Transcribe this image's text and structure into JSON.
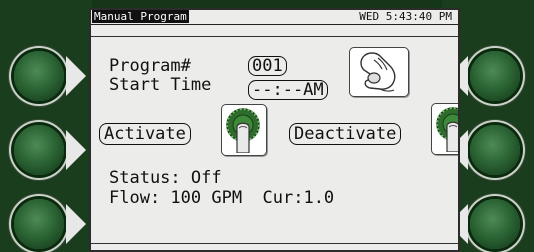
{
  "header": {
    "title": "Manual Program",
    "clock": "WED 5:43:40 PM"
  },
  "program": {
    "label": "Program#",
    "number": "001",
    "start_label": "Start Time",
    "start_value": "--:--AM"
  },
  "buttons": {
    "activate": "Activate",
    "deactivate": "Deactivate"
  },
  "status": {
    "status_line": "Status: Off",
    "flow_line": "Flow: 100 GPM  Cur:1.0"
  },
  "colors": {
    "bezel": "#16361a",
    "button_green": "#2c6535",
    "screen_bg": "#ececea",
    "dial_green": "#2e6b2c"
  },
  "icons": [
    "hand-knob-icon",
    "finger-press-dial-icon"
  ]
}
